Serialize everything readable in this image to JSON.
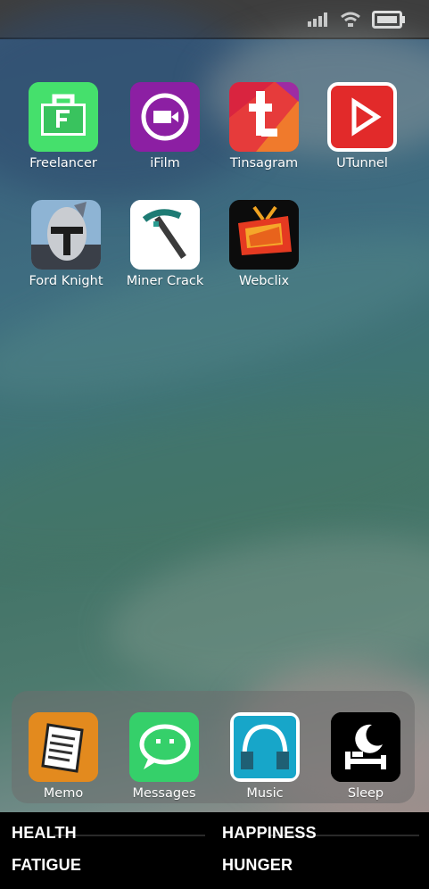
{
  "status_bar": {
    "signal_icon": "cellular-signal-icon",
    "wifi_icon": "wifi-icon",
    "battery_icon": "battery-icon"
  },
  "home": {
    "apps": [
      {
        "label": "Freelancer",
        "icon": "briefcase-icon",
        "color": "#3ddc66"
      },
      {
        "label": "iFilm",
        "icon": "video-camera-icon",
        "color": "#8a1fa0"
      },
      {
        "label": "Tinsagram",
        "icon": "letter-t-icon",
        "color": "#e8423c"
      },
      {
        "label": "UTunnel",
        "icon": "play-icon",
        "color": "#e22a2a"
      },
      {
        "label": "Ford Knight",
        "icon": "knight-helmet-icon",
        "color": "#6f94b8"
      },
      {
        "label": "Miner Crack",
        "icon": "pickaxe-icon",
        "color": "#ffffff"
      },
      {
        "label": "Webclix",
        "icon": "retro-tv-icon",
        "color": "#0c0c0c"
      }
    ]
  },
  "dock": {
    "apps": [
      {
        "label": "Memo",
        "icon": "notepad-icon",
        "color": "#e38a1e"
      },
      {
        "label": "Messages",
        "icon": "chat-bubble-icon",
        "color": "#35d06a"
      },
      {
        "label": "Music",
        "icon": "headphones-icon",
        "color": "#17a6c9"
      },
      {
        "label": "Sleep",
        "icon": "moon-bed-icon",
        "color": "#000000"
      }
    ]
  },
  "stats": {
    "health": "HEALTH",
    "happiness": "HAPPINESS",
    "fatigue": "FATIGUE",
    "hunger": "HUNGER"
  }
}
